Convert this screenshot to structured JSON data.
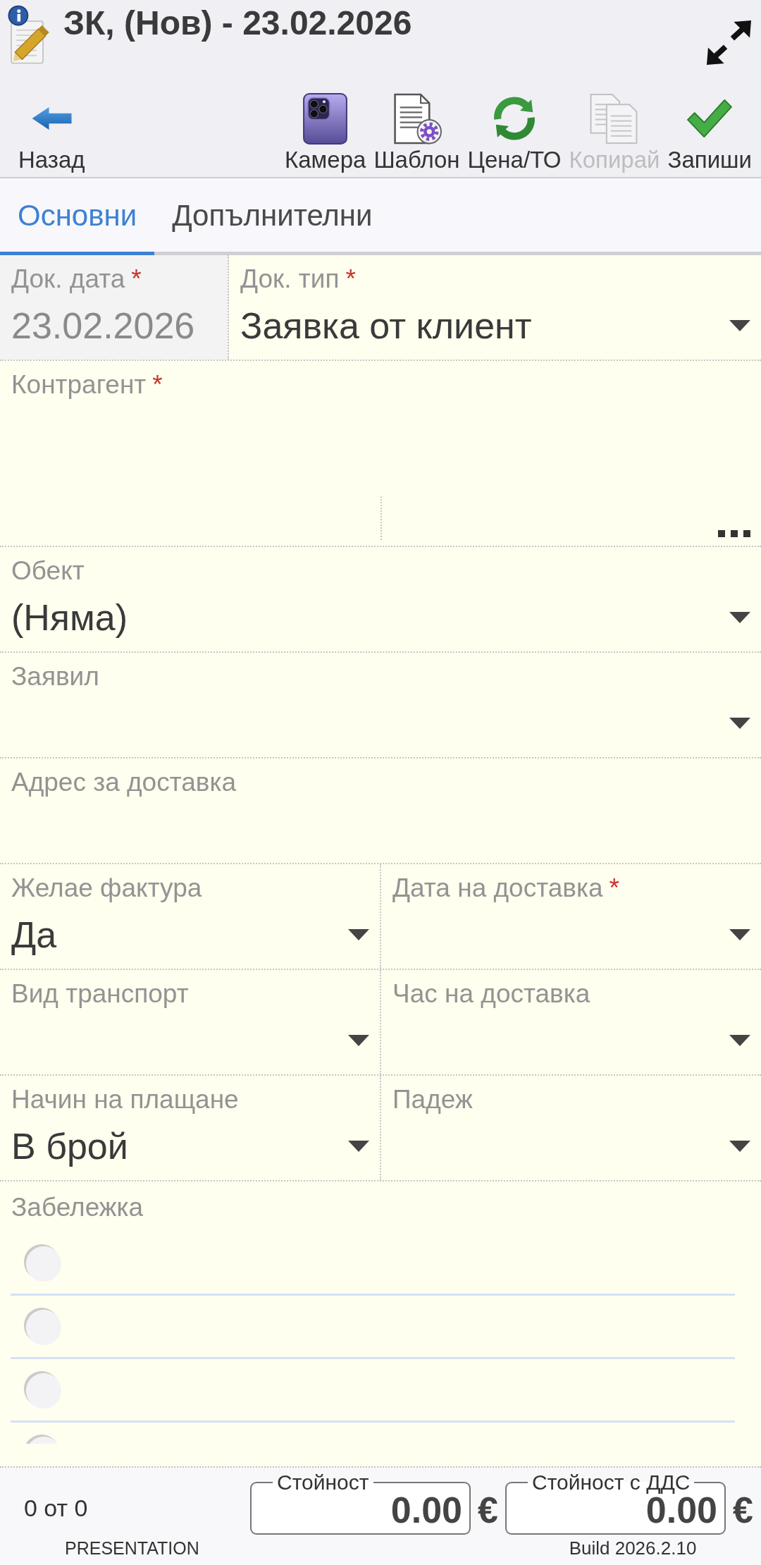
{
  "header": {
    "title": "ЗК, (Нов) - 23.02.2026"
  },
  "toolbar": {
    "back": {
      "label": "Назад"
    },
    "actions": [
      {
        "kind": "camera",
        "label": "Камера",
        "disabled": false
      },
      {
        "kind": "template",
        "label": "Шаблон",
        "disabled": false
      },
      {
        "kind": "price",
        "label": "Цена/ТО",
        "disabled": false
      },
      {
        "kind": "copy",
        "label": "Копирай",
        "disabled": true
      },
      {
        "kind": "save",
        "label": "Запиши",
        "disabled": false
      }
    ]
  },
  "tabs": [
    {
      "label": "Основни",
      "selected": true
    },
    {
      "label": "Допълнителни",
      "selected": false
    }
  ],
  "form": {
    "rows": [
      {
        "fields": [
          {
            "kind": "date",
            "label": "Док. дата",
            "required_mark": "*",
            "value": "23.02.2026",
            "disabled": true
          },
          {
            "kind": "dropdown",
            "label": "Док. тип",
            "required_mark": "*",
            "value": "Заявка от клиент",
            "disabled": false
          }
        ]
      },
      {
        "fields": [
          {
            "kind": "lookup",
            "label": "Контрагент",
            "required_mark": "*",
            "disabled": false
          }
        ]
      },
      {
        "fields": [
          {
            "kind": "dropdown",
            "label": "Обект",
            "value": "(Няма)",
            "disabled": false
          }
        ]
      },
      {
        "fields": [
          {
            "kind": "dropdown",
            "label": "Заявил",
            "disabled": false
          }
        ]
      },
      {
        "fields": [
          {
            "kind": "text",
            "label": "Адрес за доставка",
            "disabled": false
          }
        ]
      },
      {
        "fields": [
          {
            "kind": "dropdown",
            "label": "Желае фактура",
            "value": "Да",
            "disabled": false
          },
          {
            "kind": "dropdown",
            "label": "Дата на доставка",
            "required_mark": "*",
            "disabled": false
          }
        ]
      },
      {
        "fields": [
          {
            "kind": "dropdown",
            "label": "Вид транспорт",
            "disabled": false
          },
          {
            "kind": "dropdown",
            "label": "Час на доставка",
            "disabled": false
          }
        ]
      },
      {
        "fields": [
          {
            "kind": "dropdown",
            "label": "Начин на плащане",
            "value": "В брой",
            "disabled": false
          },
          {
            "kind": "dropdown",
            "label": "Падеж",
            "disabled": false
          }
        ]
      }
    ]
  },
  "note": {
    "label": "Забележка",
    "items": [
      {
        "checked": false
      },
      {
        "checked": false
      },
      {
        "checked": false
      },
      {
        "checked": false
      }
    ]
  },
  "footer": {
    "record_position": "0 от 0",
    "totals": [
      {
        "label": "Стойност",
        "value": "0.00",
        "currency": "€"
      },
      {
        "label": "Стойност с ДДС",
        "value": "0.00",
        "currency": "€"
      }
    ],
    "mode": "PRESENTATION",
    "build": "Build 2026.2.10"
  }
}
